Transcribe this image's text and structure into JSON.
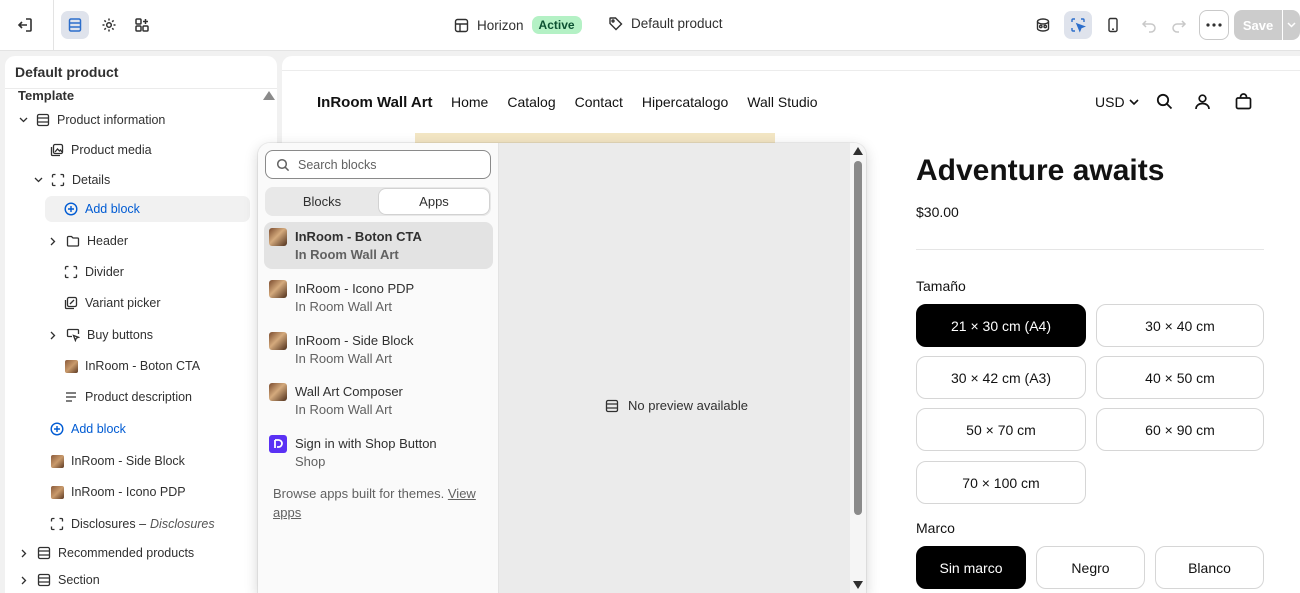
{
  "topbar": {
    "theme_name": "Horizon",
    "theme_status": "Active",
    "template_name": "Default product",
    "save_label": "Save"
  },
  "sidebar": {
    "title": "Default product",
    "section": "Template",
    "items": [
      {
        "label": "Product information"
      },
      {
        "label": "Product media"
      },
      {
        "label": "Details"
      },
      {
        "label": "Add block"
      },
      {
        "label": "Header"
      },
      {
        "label": "Divider"
      },
      {
        "label": "Variant picker"
      },
      {
        "label": "Buy buttons"
      },
      {
        "label": "InRoom - Boton CTA"
      },
      {
        "label": "Product description"
      },
      {
        "label": "Add block"
      },
      {
        "label": "InRoom - Side Block"
      },
      {
        "label": "InRoom - Icono PDP"
      },
      {
        "label": "Disclosures –",
        "sub": "Disclosures"
      },
      {
        "label": "Recommended products"
      },
      {
        "label": "Section"
      }
    ]
  },
  "store": {
    "name": "InRoom Wall Art",
    "nav": [
      "Home",
      "Catalog",
      "Contact",
      "Hipercatalogo",
      "Wall Studio"
    ],
    "currency": "USD",
    "product_title": "Adventure awaits",
    "price": "$30.00",
    "size_label": "Tamaño",
    "sizes": [
      "21 × 30 cm (A4)",
      "30 × 40 cm",
      "30 × 42 cm (A3)",
      "40 × 50 cm",
      "50 × 70 cm",
      "60 × 90 cm",
      "70 × 100 cm"
    ],
    "selected_size": "21 × 30 cm (A4)",
    "frame_label": "Marco",
    "frames": [
      "Sin marco",
      "Negro",
      "Blanco"
    ],
    "selected_frame": "Sin marco"
  },
  "picker": {
    "search_placeholder": "Search blocks",
    "tabs": [
      "Blocks",
      "Apps"
    ],
    "active_tab": "Apps",
    "apps": [
      {
        "name": "InRoom - Boton CTA",
        "vendor": "In Room Wall Art"
      },
      {
        "name": "InRoom - Icono PDP",
        "vendor": "In Room Wall Art"
      },
      {
        "name": "InRoom - Side Block",
        "vendor": "In Room Wall Art"
      },
      {
        "name": "Wall Art Composer",
        "vendor": "In Room Wall Art"
      },
      {
        "name": "Sign in with Shop Button",
        "vendor": "Shop"
      }
    ],
    "browse_text": "Browse apps built for themes.",
    "browse_link": "View apps",
    "no_preview": "No preview available"
  },
  "colors": {
    "accent_blue": "#005bd3",
    "active_badge": "#b4f1c5",
    "selected_pill": "#000000"
  }
}
